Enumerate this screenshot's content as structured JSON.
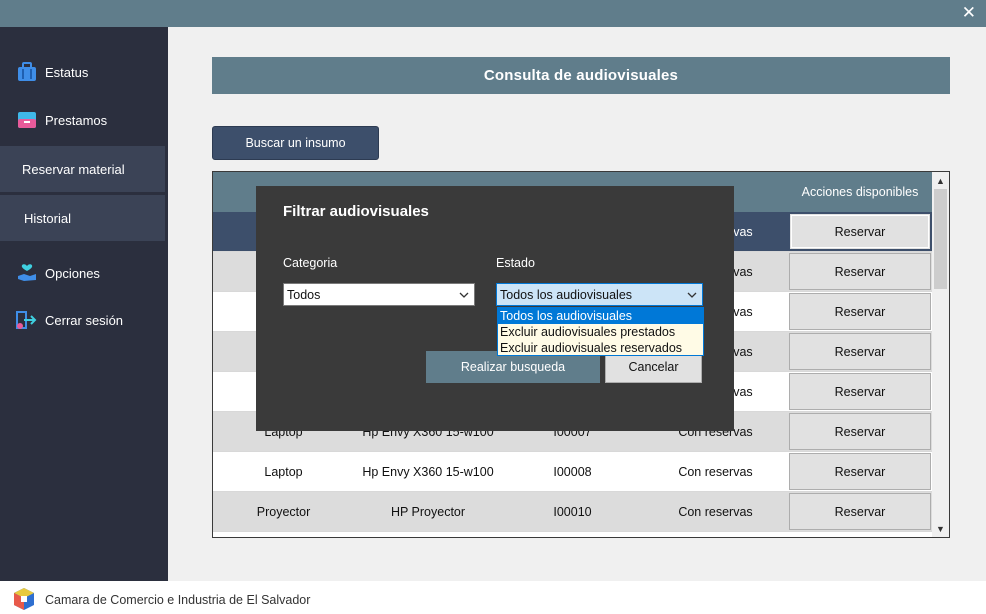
{
  "window": {
    "close_glyph": "✕"
  },
  "sidebar": {
    "items": [
      {
        "label": "Estatus",
        "icon": "briefcase-icon"
      },
      {
        "label": "Prestamos",
        "icon": "drawer-icon"
      },
      {
        "label": "Reservar material"
      },
      {
        "label": "Historial"
      },
      {
        "label": "Opciones",
        "icon": "hand-heart-icon"
      },
      {
        "label": "Cerrar sesión",
        "icon": "logout-icon"
      }
    ]
  },
  "main": {
    "title": "Consulta de audiovisuales",
    "search_button": "Buscar un insumo",
    "table": {
      "actions_header": "Acciones disponibles",
      "reserve_label": "Reservar",
      "rows": [
        {
          "c1": "",
          "c2": "",
          "c3": "",
          "c4": "Con reservas"
        },
        {
          "c1": "",
          "c2": "",
          "c3": "",
          "c4": "Con reservas"
        },
        {
          "c1": "",
          "c2": "",
          "c3": "",
          "c4": "Con reservas"
        },
        {
          "c1": "",
          "c2": "",
          "c3": "",
          "c4": "Con reservas"
        },
        {
          "c1": "",
          "c2": "",
          "c3": "",
          "c4": "Con reservas"
        },
        {
          "c1": "Laptop",
          "c2": "Hp Envy X360 15-w100",
          "c3": "I00007",
          "c4": "Con reservas"
        },
        {
          "c1": "Laptop",
          "c2": "Hp Envy X360 15-w100",
          "c3": "I00008",
          "c4": "Con reservas"
        },
        {
          "c1": "Proyector",
          "c2": "HP Proyector",
          "c3": "I00010",
          "c4": "Con reservas"
        }
      ]
    }
  },
  "dialog": {
    "title": "Filtrar audiovisuales",
    "category_label": "Categoria",
    "category_value": "Todos",
    "state_label": "Estado",
    "state_value": "Todos los audiovisuales",
    "state_options": [
      "Todos los audiovisuales",
      "Excluir audiovisuales prestados",
      "Excluir audiovisuales reservados"
    ],
    "search_button": "Realizar busqueda",
    "cancel_button": "Cancelar"
  },
  "footer": {
    "text": "Camara de Comercio e Industria de El Salvador"
  },
  "colors": {
    "header": "#607d8b",
    "sidebar": "#2b2f3e",
    "selected_row": "#3d4f6b",
    "accent": "#0078d7"
  }
}
